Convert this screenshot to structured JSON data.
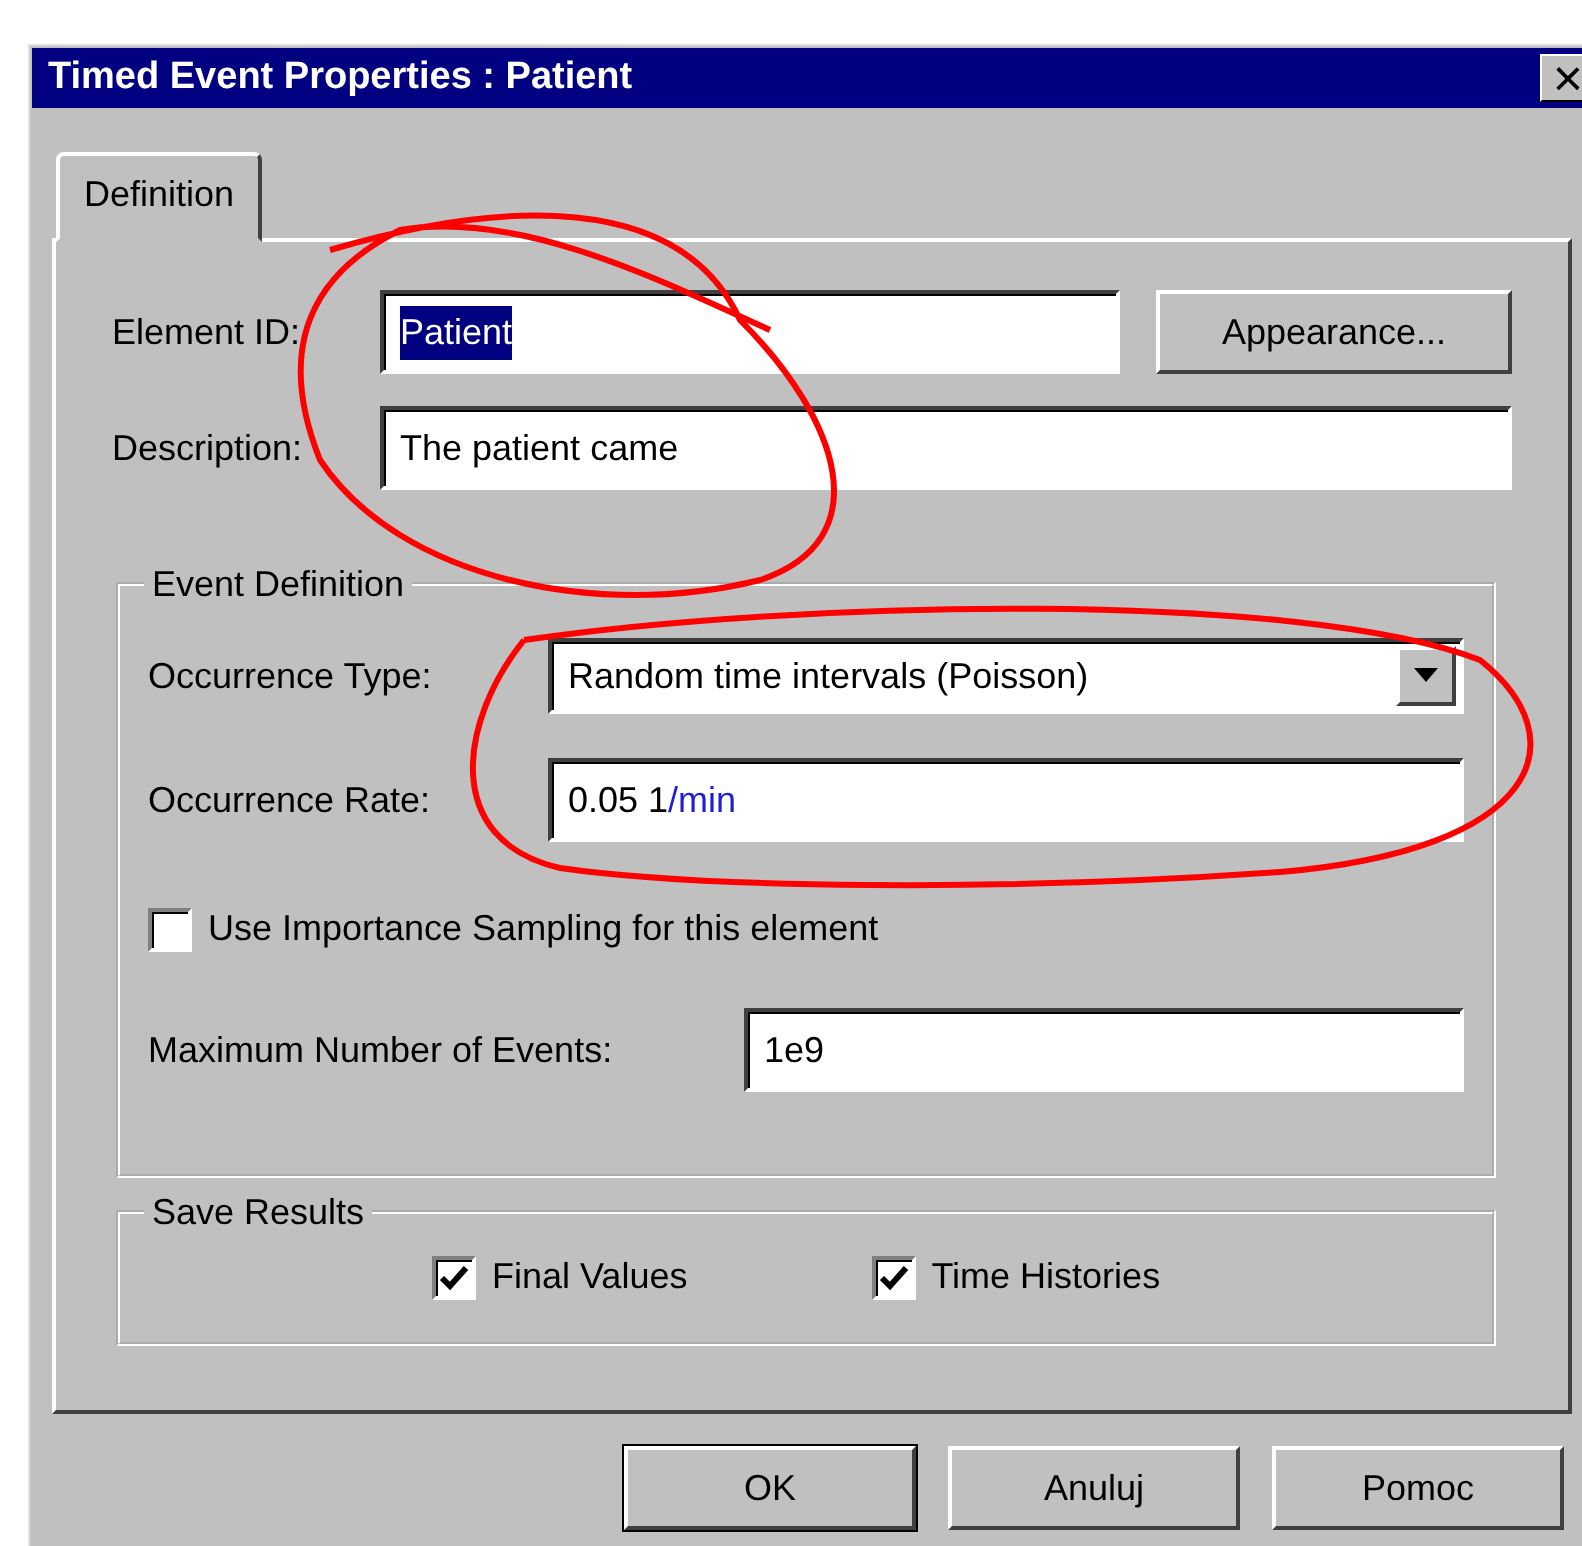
{
  "window": {
    "title": "Timed Event Properties : Patient",
    "close_glyph": "×"
  },
  "tabs": [
    {
      "label": "Definition",
      "selected": true
    }
  ],
  "element_id": {
    "label": "Element ID:",
    "value": "Patient",
    "text_selected": true
  },
  "appearance_button": "Appearance...",
  "description": {
    "label": "Description:",
    "value": "The patient came"
  },
  "event_definition": {
    "title": "Event Definition",
    "occurrence_type": {
      "label": "Occurrence Type:",
      "value": "Random time intervals (Poisson)"
    },
    "occurrence_rate": {
      "label": "Occurrence Rate:",
      "value": "0.05 1",
      "unit": "/min"
    },
    "importance_sampling": {
      "label": "Use Importance Sampling for this element",
      "checked": false
    },
    "max_events": {
      "label": "Maximum Number of Events:",
      "value": "1e9"
    }
  },
  "save_results": {
    "title": "Save Results",
    "options": [
      {
        "label": "Final Values",
        "checked": true
      },
      {
        "label": "Time Histories",
        "checked": true
      }
    ]
  },
  "buttons": [
    {
      "label": "OK",
      "default": true
    },
    {
      "label": "Anuluj",
      "default": false
    },
    {
      "label": "Pomoc",
      "default": false
    }
  ],
  "annotations": [
    {
      "kind": "freehand-loop"
    },
    {
      "kind": "freehand-loop"
    }
  ]
}
